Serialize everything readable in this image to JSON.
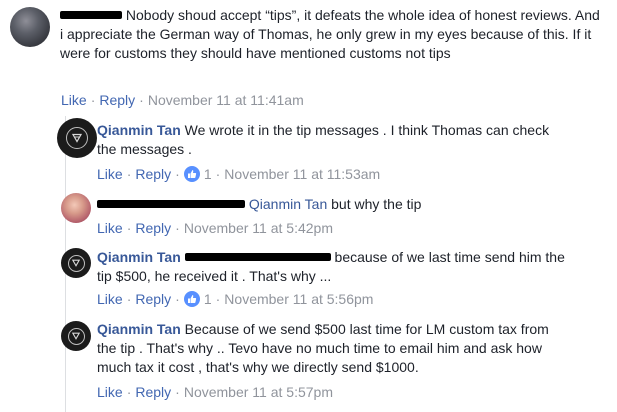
{
  "colors": {
    "link": "#4267b2",
    "author": "#385898",
    "meta": "#90949c",
    "like_badge": "#5890ff"
  },
  "comments": [
    {
      "text": "Nobody shoud accept “tips”, it defeats the whole idea of honest reviews. And i appreciate the German way of Thomas, he only grew in my eyes because of this. If it were for customs they should have mentioned customs not tips",
      "like": "Like",
      "reply": "Reply",
      "time": "November 11 at 11:41am"
    },
    {
      "author": "Qianmin Tan",
      "text": "We wrote it in the tip messages . I think Thomas can check the messages .",
      "like": "Like",
      "reply": "Reply",
      "reaction_count": "1",
      "time": "November 11 at 11:53am"
    },
    {
      "mention": "Qianmin Tan",
      "text": "but why the tip",
      "like": "Like",
      "reply": "Reply",
      "time": "November 11 at 5:42pm"
    },
    {
      "author": "Qianmin Tan",
      "text": "because of we last time send him the tip $500, he received it . That's why ...",
      "like": "Like",
      "reply": "Reply",
      "reaction_count": "1",
      "time": "November 11 at 5:56pm"
    },
    {
      "author": "Qianmin Tan",
      "text": "Because of we send $500 last time for LM custom tax from the tip . That's why .. Tevo have no much time to email him and ask how much tax it cost , that's why we directly send $1000.",
      "like": "Like",
      "reply": "Reply",
      "time": "November 11 at 5:57pm"
    }
  ]
}
